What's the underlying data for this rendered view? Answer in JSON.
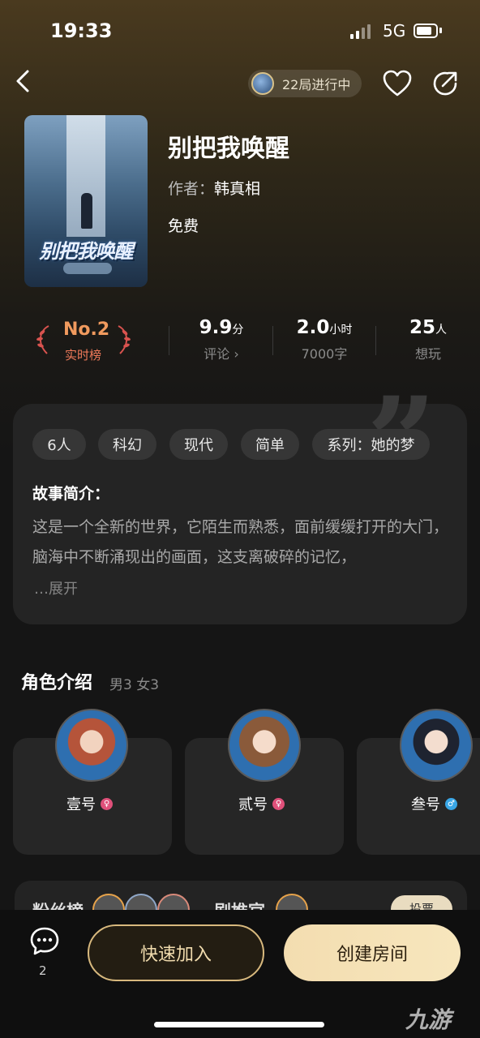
{
  "status_bar": {
    "time": "19:33",
    "network": "5G"
  },
  "header": {
    "playing_badge": "22局进行中"
  },
  "book": {
    "cover_title": "别把我唤醒",
    "title": "别把我唤醒",
    "author_label": "作者：",
    "author": "韩真相",
    "price": "免费"
  },
  "stats": {
    "rank": "No.2",
    "rank_label": "实时榜",
    "score": "9.9",
    "score_unit": "分",
    "score_sub": "评论 ›",
    "duration": "2.0",
    "duration_unit": "小时",
    "word_count": "7000字",
    "wanted": "25",
    "wanted_unit": "人",
    "wanted_sub": "想玩"
  },
  "intro": {
    "tags": [
      "6人",
      "科幻",
      "现代",
      "简单",
      "系列：她的梦"
    ],
    "section_title": "故事简介：",
    "description": "这是一个全新的世界，它陌生而熟悉，面前缓缓打开的大门，脑海中不断涌现出的画面，这支离破碎的记忆，",
    "expand": "…展开"
  },
  "characters": {
    "title": "角色介绍",
    "summary": "男3 女3",
    "items": [
      {
        "name": "壹号",
        "gender": "female"
      },
      {
        "name": "贰号",
        "gender": "female"
      },
      {
        "name": "叁号",
        "gender": "male"
      }
    ]
  },
  "bottom_peek": {
    "fan_rank": "粉丝榜",
    "recommend": "剧推官",
    "vote": "投票"
  },
  "bottom_bar": {
    "message_count": "2",
    "join": "快速加入",
    "create": "创建房间"
  },
  "watermark": "九游",
  "colors": {
    "accent_gold": "#f3ddb0",
    "rank_orange": "#f09a5e",
    "female_pink": "#e0507a",
    "male_blue": "#39a6e6"
  }
}
